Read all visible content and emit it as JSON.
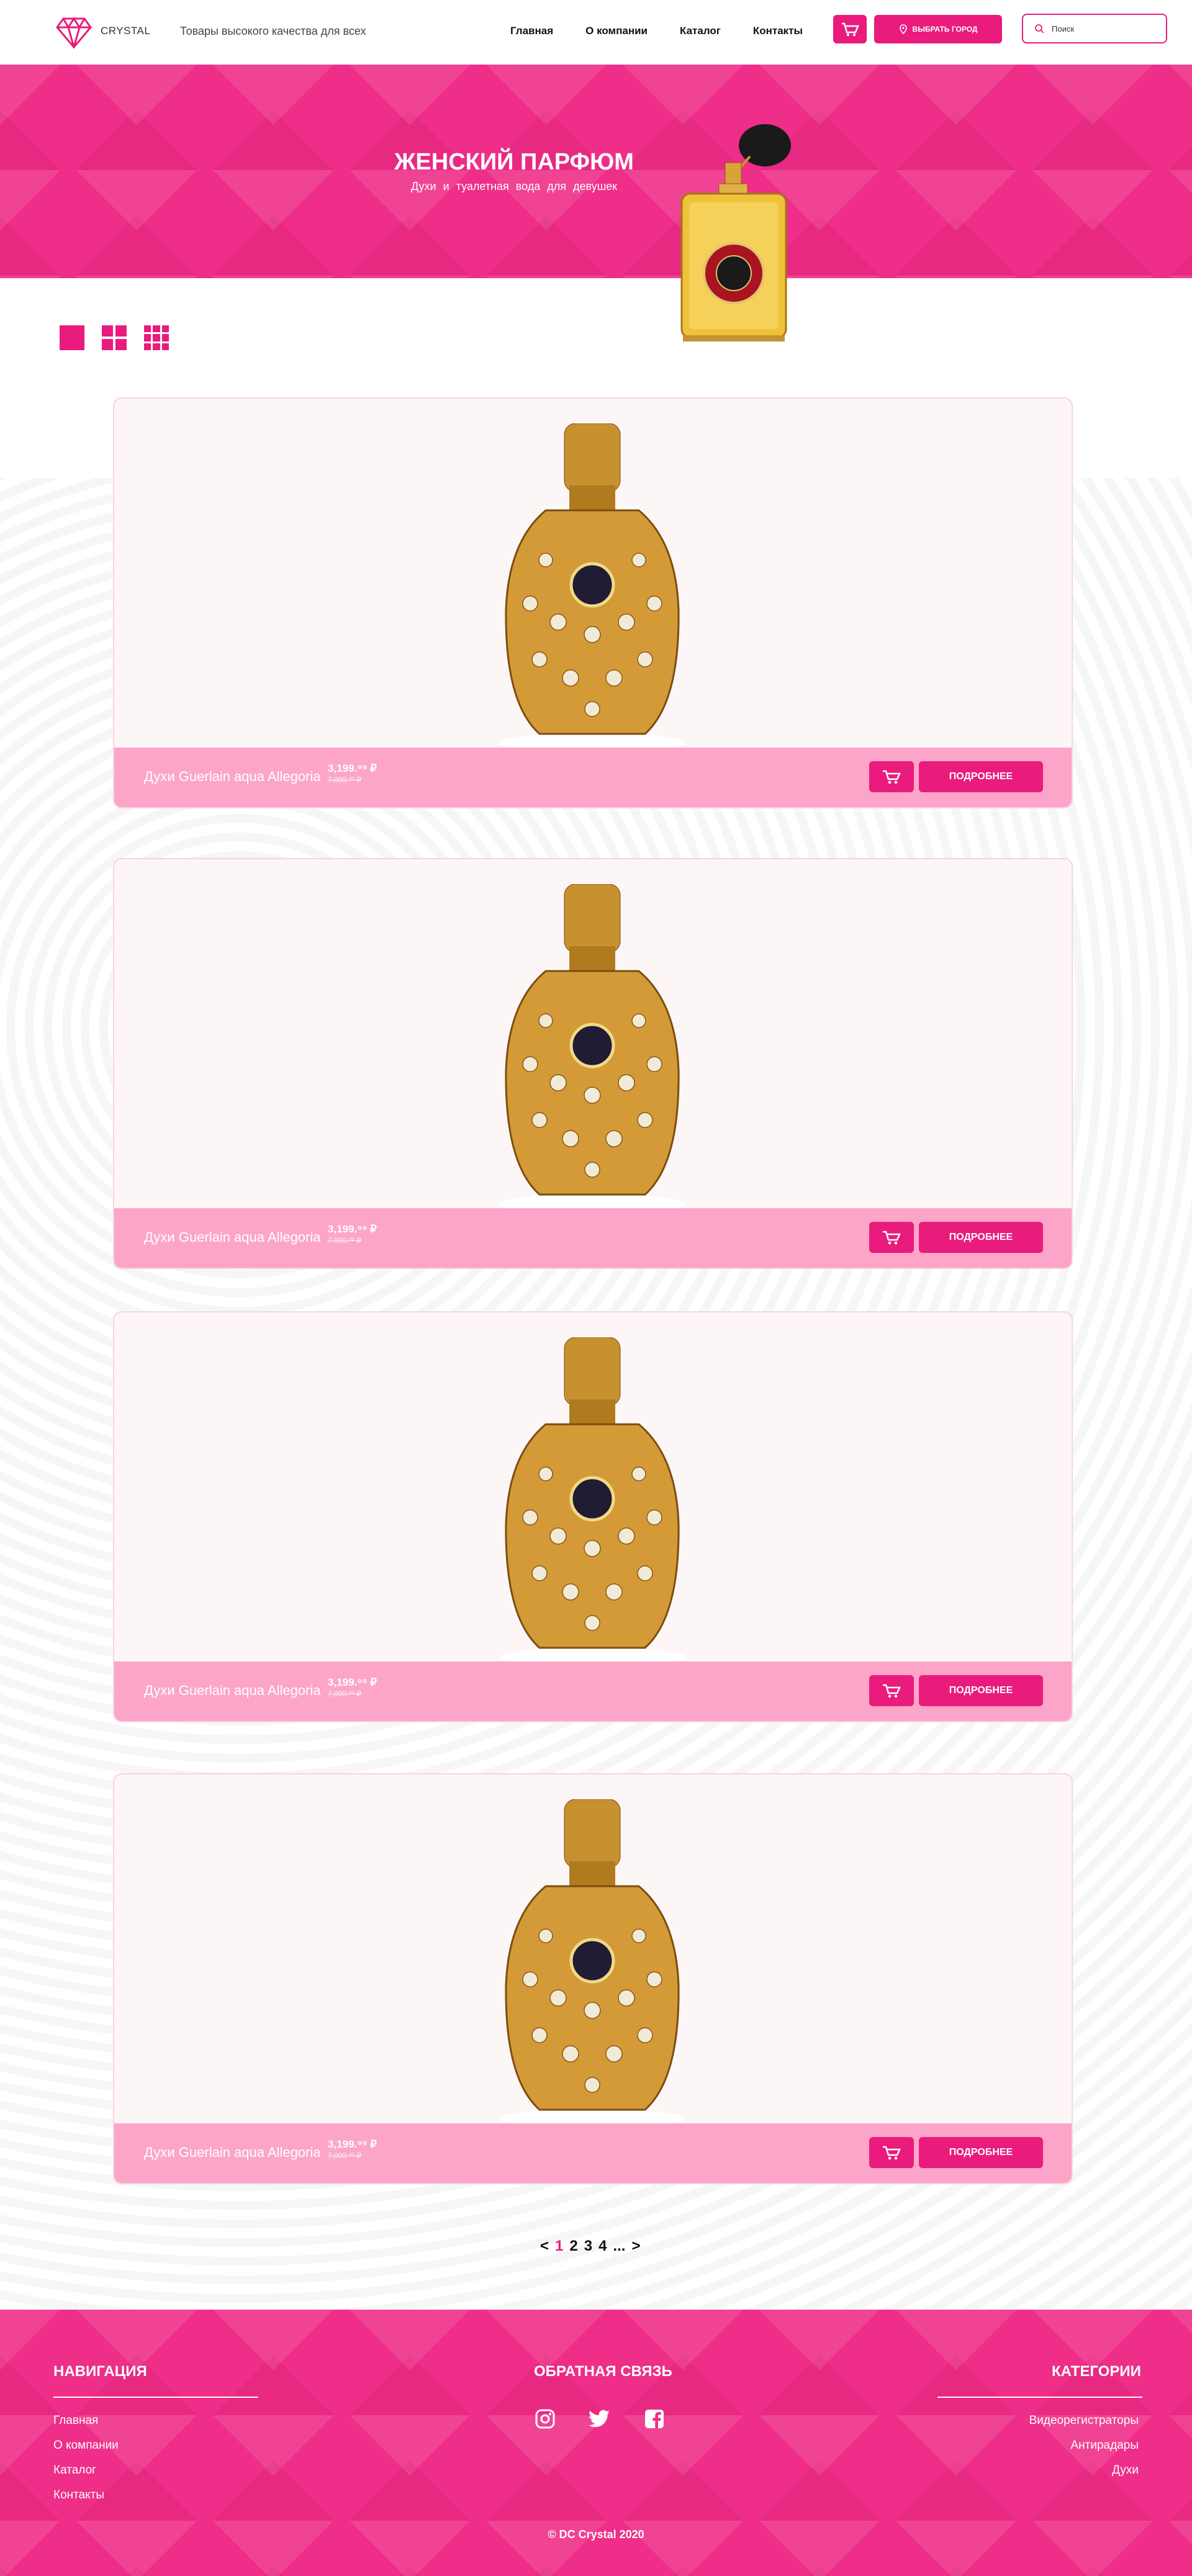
{
  "header": {
    "logo_text": "CRYSTAL",
    "tagline": "Товары высокого качества для всех",
    "nav": [
      "Главная",
      "О компании",
      "Каталог",
      "Контакты"
    ],
    "city_button": "ВЫБРАТЬ ГОРОД",
    "search_placeholder": "Поиск"
  },
  "hero": {
    "title": "ЖЕНСКИЙ ПАРФЮМ",
    "subtitle": "Духи и туалетная вода для девушек"
  },
  "products": [
    {
      "name": "Духи Guerlain aqua Allegoria",
      "price": "3,199.⁹⁹ ₽",
      "old_price": "7,000.⁰⁰ ₽",
      "more": "ПОДРОБНЕЕ"
    },
    {
      "name": "Духи Guerlain aqua Allegoria",
      "price": "3,199.⁹⁹ ₽",
      "old_price": "7,000.⁰⁰ ₽",
      "more": "ПОДРОБНЕЕ"
    },
    {
      "name": "Духи Guerlain aqua Allegoria",
      "price": "3,199.⁹⁹ ₽",
      "old_price": "7,000.⁰⁰ ₽",
      "more": "ПОДРОБНЕЕ"
    },
    {
      "name": "Духи Guerlain aqua Allegoria",
      "price": "3,199.⁹⁹ ₽",
      "old_price": "7,000.⁰⁰ ₽",
      "more": "ПОДРОБНЕЕ"
    }
  ],
  "pagination": {
    "prev": "<",
    "pages": [
      "1",
      "2",
      "3",
      "4"
    ],
    "ellipsis": "...",
    "next": ">",
    "active": "1"
  },
  "footer": {
    "nav_title": "НАВИГАЦИЯ",
    "nav_items": [
      "Главная",
      "О компании",
      "Каталог",
      "Контакты"
    ],
    "feedback_title": "ОБРАТНАЯ СВЯЗЬ",
    "social_icons": [
      "instagram-icon",
      "twitter-icon",
      "facebook-icon"
    ],
    "categories_title": "КАТЕГОРИИ",
    "categories": [
      "Видеорегистраторы",
      "Антирадары",
      "Духи"
    ],
    "copyright": "© DC Crystal 2020"
  },
  "colors": {
    "accent": "#e91b7d",
    "hero_bg": "#ee2e88",
    "card_bar": "#fca5c9",
    "card_bg": "#fdf6f7"
  }
}
